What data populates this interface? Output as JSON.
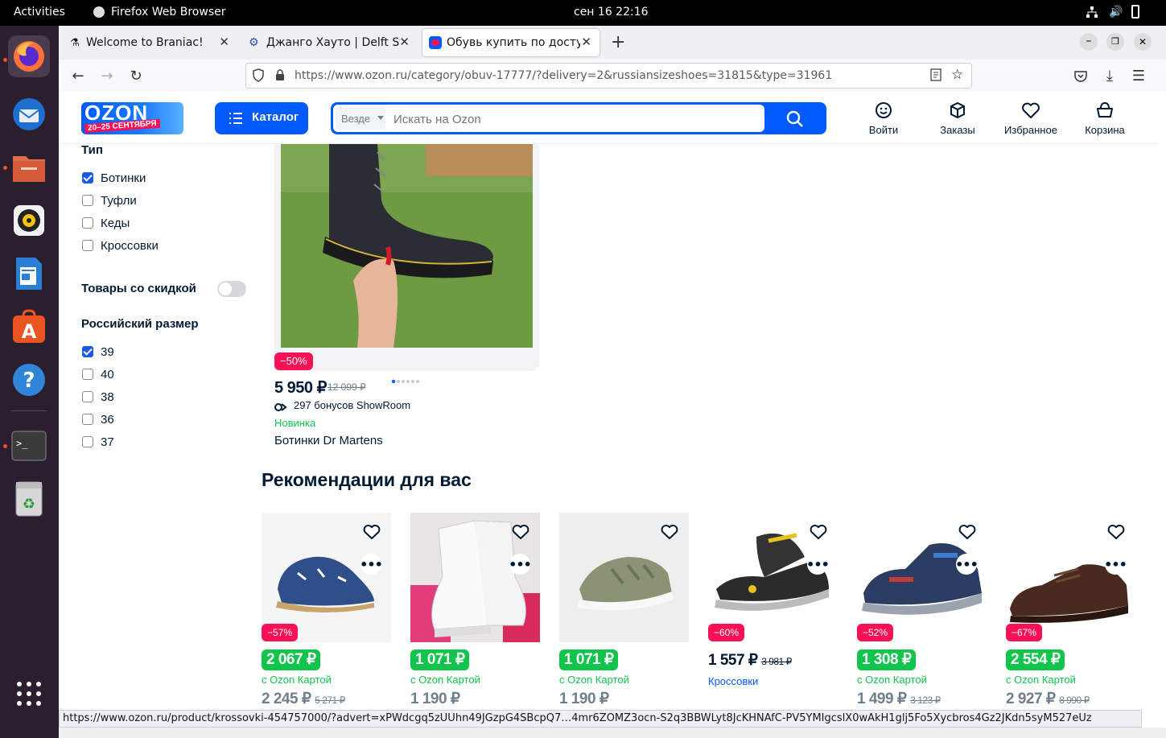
{
  "system": {
    "activities": "Activities",
    "app_name": "Firefox Web Browser",
    "clock": "сен 16  22:16"
  },
  "dock": {
    "items": [
      "firefox-icon",
      "thunderbird-icon",
      "files-icon",
      "rhythmbox-icon",
      "libreoffice-writer-icon",
      "app-center-icon",
      "help-icon",
      "terminal-icon",
      "trash-icon",
      "show-apps-icon"
    ]
  },
  "browser": {
    "tabs": [
      {
        "title": "Welcome to Braniac!"
      },
      {
        "title": "Джанго Хауто | Delft Sta"
      },
      {
        "title": "Обувь купить по доступ"
      }
    ],
    "url": "https://www.ozon.ru/category/obuv-17777/?delivery=2&russiansizeshoes=31815&type=31961",
    "status_url": "https://www.ozon.ru/product/krossovki-454757000/?advert=xPWdcgq5zUUhn49JGzpG4SBcpQ7…4mr6ZOMZ3ocn-S2q3BBWLyt8JcKHNAfC-PV5YMIgcslX0wAkH1glj5Fo5Xycbros4Gz2JKdn5syM527eUz"
  },
  "header": {
    "logo_text": "OZON",
    "logo_sub": "20–25 СЕНТЯБРЯ",
    "catalog": "Каталог",
    "search_scope": "Везде",
    "search_placeholder": "Искать на Ozon",
    "actions": [
      {
        "label": "Войти",
        "icon": "smile-icon"
      },
      {
        "label": "Заказы",
        "icon": "box-icon"
      },
      {
        "label": "Избранное",
        "icon": "heart-icon"
      },
      {
        "label": "Корзина",
        "icon": "basket-icon"
      }
    ]
  },
  "filters": {
    "type_title": "Тип",
    "types": [
      {
        "label": "Ботинки",
        "checked": true
      },
      {
        "label": "Туфли",
        "checked": false
      },
      {
        "label": "Кеды",
        "checked": false
      },
      {
        "label": "Кроссовки",
        "checked": false
      }
    ],
    "discount_label": "Товары со скидкой",
    "size_title": "Российский размер",
    "sizes": [
      {
        "label": "39",
        "checked": true
      },
      {
        "label": "40",
        "checked": false
      },
      {
        "label": "38",
        "checked": false
      },
      {
        "label": "36",
        "checked": false
      },
      {
        "label": "37",
        "checked": false
      }
    ]
  },
  "product": {
    "discount": "−50%",
    "price": "5 950 ₽",
    "old_price": "12 099 ₽",
    "bonus": "297 бонусов ShowRoom",
    "badge": "Новинка",
    "name": "Ботинки Dr Martens"
  },
  "recommendations": {
    "title": "Рекомендации для вас",
    "items": [
      {
        "discount": "−57%",
        "price": "2 067 ₽",
        "card_label": "с Ozon Картой",
        "regular_price": "2 245 ₽",
        "old_price": "5 271 ₽",
        "image": "sandal-blue-kids-icon"
      },
      {
        "discount": "",
        "price": "1 071 ₽",
        "card_label": "с Ozon Картой",
        "regular_price": "1 190 ₽",
        "old_price": "",
        "image": "white-sneaker-boot-icon"
      },
      {
        "discount": "",
        "price": "1 071 ₽",
        "card_label": "с Ozon Картой",
        "regular_price": "1 190 ₽",
        "old_price": "",
        "image": "khaki-kids-shoe-icon"
      },
      {
        "discount": "−60%",
        "price": "1 557 ₽",
        "old_price": "3 981 ₽",
        "category": "Кроссовки",
        "image": "black-sandal-icon"
      },
      {
        "discount": "−52%",
        "price": "1 308 ₽",
        "card_label": "с Ozon Картой",
        "regular_price": "1 499 ₽",
        "old_price": "3 123 ₽",
        "image": "navy-sandal-icon"
      },
      {
        "discount": "−67%",
        "price": "2 554 ₽",
        "card_label": "с Ozon Картой",
        "regular_price": "2 927 ₽",
        "old_price": "8 990 ₽",
        "image": "brown-shoe-icon"
      }
    ]
  },
  "colors": {
    "ozon_blue": "#005bff",
    "discount_red": "#f91155",
    "price_green": "#10c44c",
    "ubuntu_orange": "#e95420"
  }
}
